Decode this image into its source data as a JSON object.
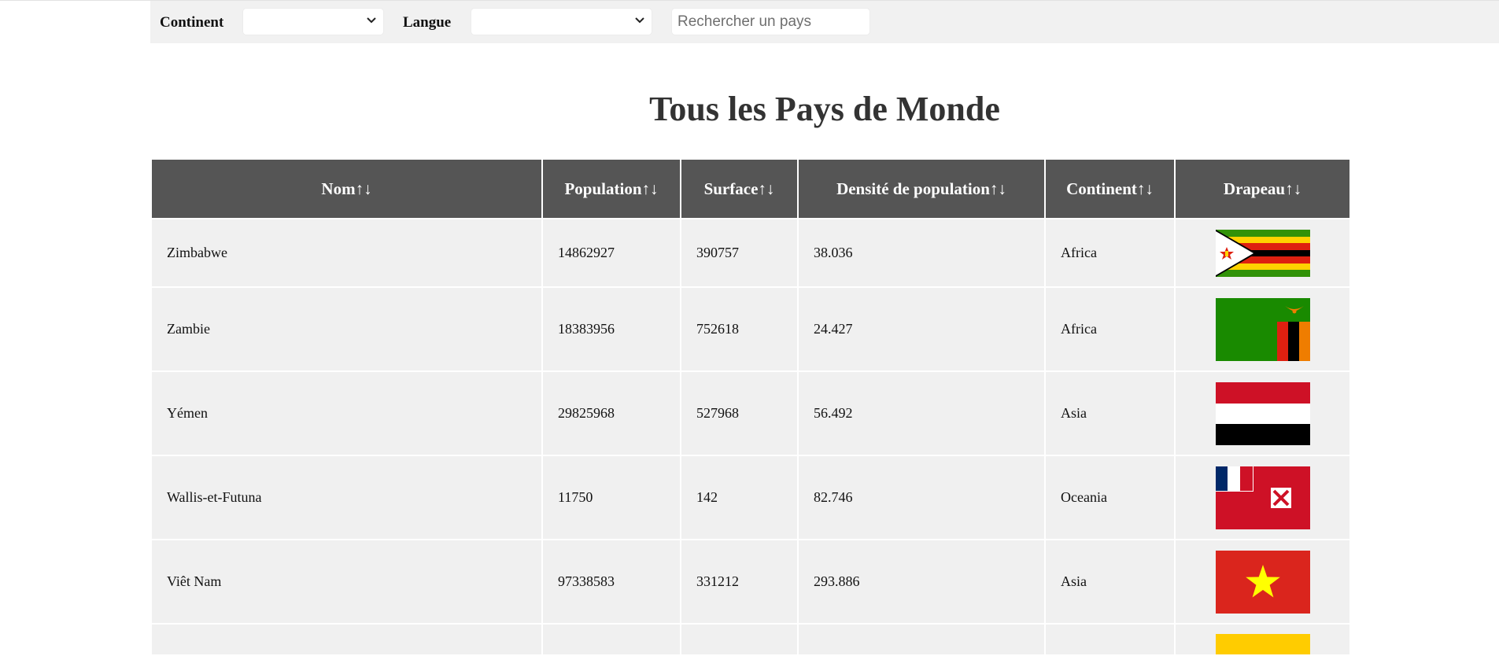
{
  "filters": {
    "continent_label": "Continent",
    "continent_value": "",
    "langue_label": "Langue",
    "langue_value": "",
    "search_placeholder": "Rechercher un pays",
    "search_value": ""
  },
  "title": "Tous les Pays de Monde",
  "table": {
    "headers": [
      "Nom↑↓",
      "Population↑↓",
      "Surface↑↓",
      "Densité de population↑↓",
      "Continent↑↓",
      "Drapeau↑↓"
    ],
    "rows": [
      {
        "nom": "Zimbabwe",
        "population": "14862927",
        "surface": "390757",
        "densite": "38.036",
        "continent": "Africa",
        "flag": "zimbabwe-flag"
      },
      {
        "nom": "Zambie",
        "population": "18383956",
        "surface": "752618",
        "densite": "24.427",
        "continent": "Africa",
        "flag": "zambia-flag"
      },
      {
        "nom": "Yémen",
        "population": "29825968",
        "surface": "527968",
        "densite": "56.492",
        "continent": "Asia",
        "flag": "yemen-flag"
      },
      {
        "nom": "Wallis-et-Futuna",
        "population": "11750",
        "surface": "142",
        "densite": "82.746",
        "continent": "Oceania",
        "flag": "wallis-futuna-flag"
      },
      {
        "nom": "Viêt Nam",
        "population": "97338583",
        "surface": "331212",
        "densite": "293.886",
        "continent": "Asia",
        "flag": "vietnam-flag"
      },
      {
        "nom": "",
        "population": "",
        "surface": "",
        "densite": "",
        "continent": "",
        "flag": "partial-yellow-flag"
      }
    ]
  },
  "colors": {
    "header_bg": "#555555",
    "row_bg": "#f0f0f0",
    "filter_bar_bg": "#f1f1f1"
  }
}
